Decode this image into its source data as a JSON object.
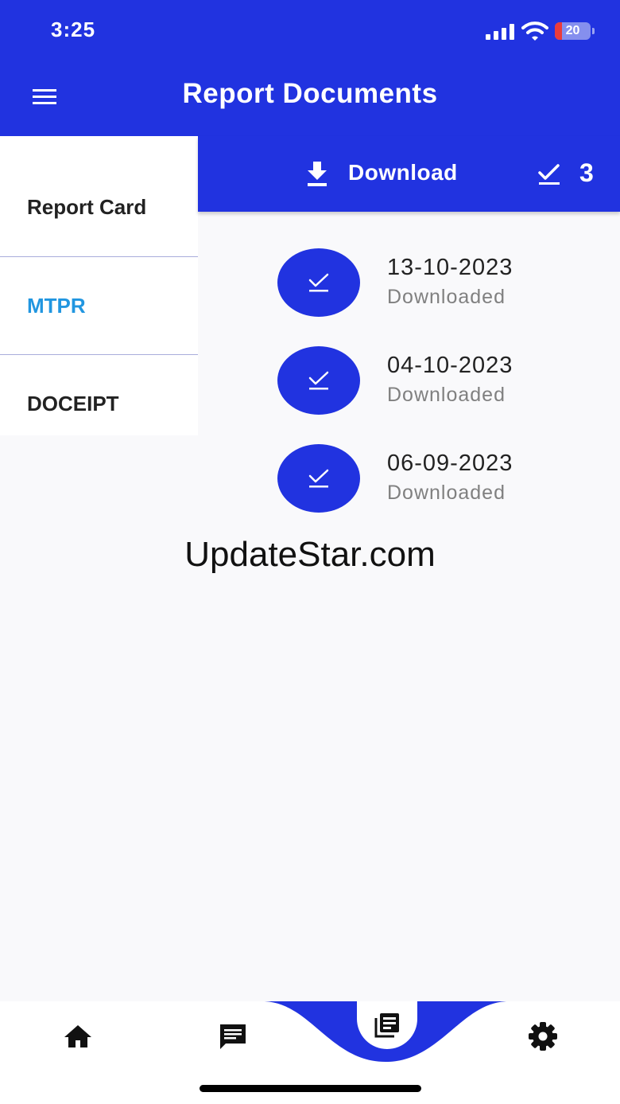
{
  "status_bar": {
    "time": "3:25",
    "battery": "20",
    "battery_level": 0.2
  },
  "header": {
    "title": "Report Documents"
  },
  "sidebar": {
    "items": [
      {
        "label": "Report Card",
        "color": "#222222"
      },
      {
        "label": "MTPR",
        "color": "#2196e0",
        "selected": true
      },
      {
        "label": "DOCEIPT",
        "color": "#222222"
      }
    ]
  },
  "download_bar": {
    "label": "Download",
    "selected_count": "3"
  },
  "documents": [
    {
      "date": "13-10-2023",
      "status": "Downloaded"
    },
    {
      "date": "04-10-2023",
      "status": "Downloaded"
    },
    {
      "date": "06-09-2023",
      "status": "Downloaded"
    }
  ],
  "watermark": "UpdateStar.com",
  "bottom_nav": {
    "items": [
      {
        "icon": "home-icon"
      },
      {
        "icon": "chat-icon"
      },
      {
        "icon": "documents-icon",
        "active": true
      },
      {
        "icon": "settings-icon"
      }
    ]
  },
  "colors": {
    "primary": "#2133e0",
    "selected_text": "#2196e0",
    "muted_text": "#808080"
  }
}
